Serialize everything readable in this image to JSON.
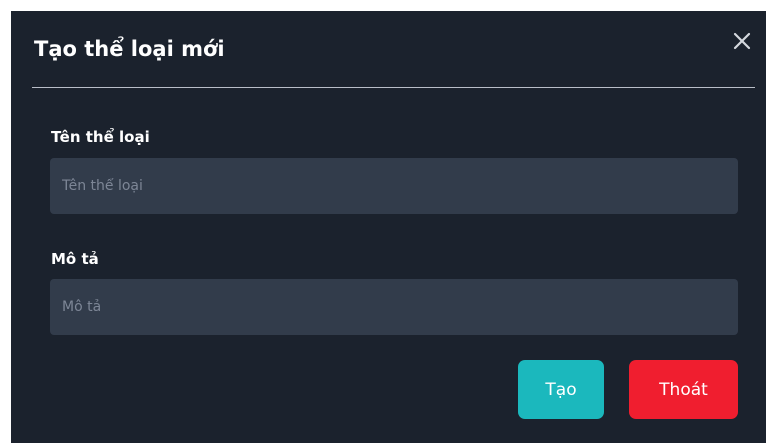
{
  "dialog": {
    "title": "Tạo thể loại mới",
    "close_icon": "close-icon"
  },
  "form": {
    "name_label": "Tên thể loại",
    "name_placeholder": "Tên thể loại",
    "name_value": "",
    "description_label": "Mô tả",
    "description_placeholder": "Mô tả",
    "description_value": ""
  },
  "actions": {
    "create_label": "Tạo",
    "exit_label": "Thoát"
  },
  "colors": {
    "dialog_background": "#1b222d",
    "input_background": "#323c4b",
    "create_button": "#1bb8bd",
    "exit_button": "#f01e2f"
  }
}
